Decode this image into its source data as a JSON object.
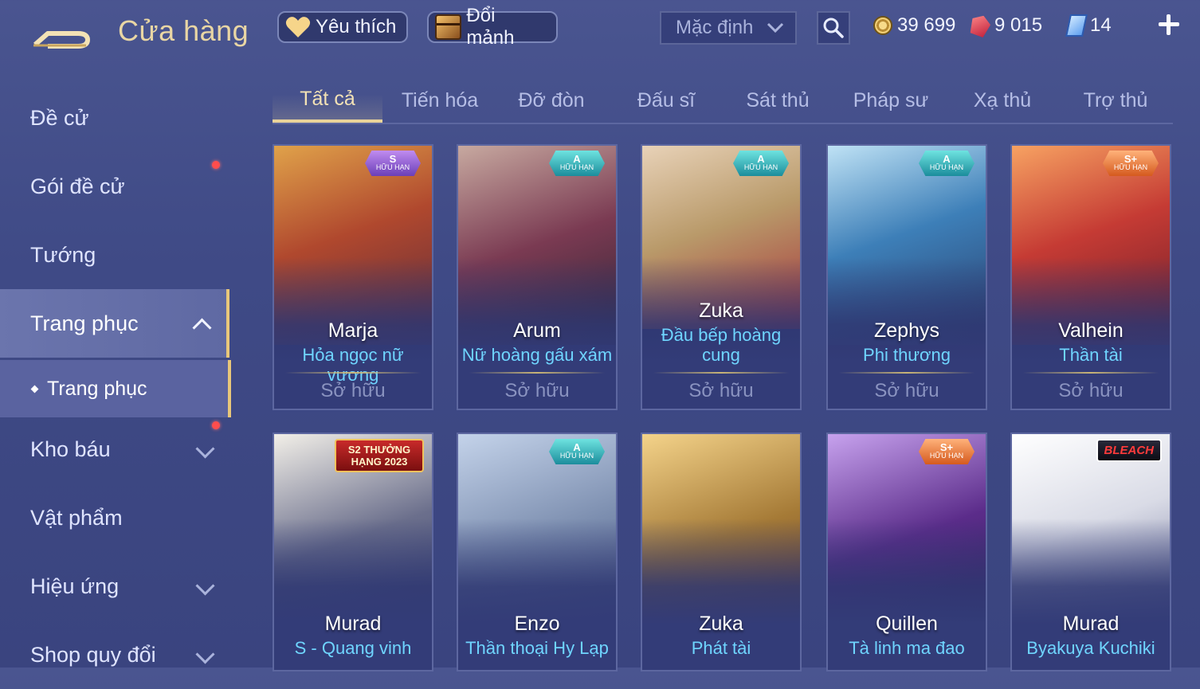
{
  "header": {
    "title": "Cửa hàng",
    "favorites_label": "Yêu thích",
    "exchange_label": "Đổi mảnh",
    "sort_value": "Mặc định"
  },
  "currencies": {
    "gold": "39 699",
    "ruby": "9 015",
    "voucher": "14"
  },
  "sidebar": {
    "items": [
      {
        "label": "Đề cử"
      },
      {
        "label": "Gói đề cử"
      },
      {
        "label": "Tướng"
      },
      {
        "label": "Trang phục"
      },
      {
        "label": "Kho báu"
      },
      {
        "label": "Vật phẩm"
      },
      {
        "label": "Hiệu ứng"
      },
      {
        "label": "Shop quy đổi"
      }
    ],
    "sub_item": "Trang phục"
  },
  "tabs": [
    "Tất cả",
    "Tiến hóa",
    "Đỡ đòn",
    "Đấu sĩ",
    "Sát thủ",
    "Pháp sư",
    "Xạ thủ",
    "Trợ thủ"
  ],
  "cards": [
    {
      "hero": "Marja",
      "skin": "Hỏa ngọc nữ vương",
      "status": "Sở hữu",
      "badge_tier": "S",
      "badge_text": "HỮU HẠN",
      "color": "#b0482e"
    },
    {
      "hero": "Arum",
      "skin": "Nữ hoàng gấu xám",
      "status": "Sở hữu",
      "badge_tier": "A",
      "badge_text": "HỮU HẠN",
      "color": "#7a3a52"
    },
    {
      "hero": "Zuka",
      "skin": "Đầu bếp hoàng cung",
      "status": "Sở hữu",
      "badge_tier": "A",
      "badge_text": "HỮU HẠN",
      "color": "#b99a6a"
    },
    {
      "hero": "Zephys",
      "skin": "Phi thương",
      "status": "Sở hữu",
      "badge_tier": "A",
      "badge_text": "HỮU HẠN",
      "color": "#3d7fb8"
    },
    {
      "hero": "Valhein",
      "skin": "Thần tài",
      "status": "Sở hữu",
      "badge_tier": "S+",
      "badge_text": "HỮU HẠN",
      "color": "#c53b34"
    },
    {
      "hero": "Murad",
      "skin": "S - Quang vinh",
      "badge_label": "S2 THƯỞNG HẠNG 2023",
      "color": "#6b6f8c"
    },
    {
      "hero": "Enzo",
      "skin": "Thần thoại Hy Lạp",
      "badge_tier": "A",
      "badge_text": "HỮU HẠN",
      "color": "#7d8fb0"
    },
    {
      "hero": "Zuka",
      "skin": "Phát tài",
      "color": "#a57a36"
    },
    {
      "hero": "Quillen",
      "skin": "Tà linh ma đao",
      "badge_tier": "S+",
      "badge_text": "HỮU HẠN",
      "color": "#5b2c8a"
    },
    {
      "hero": "Murad",
      "skin": "Byakuya Kuchiki",
      "badge_label": "BLEACH",
      "color": "#d9dbe6"
    }
  ]
}
